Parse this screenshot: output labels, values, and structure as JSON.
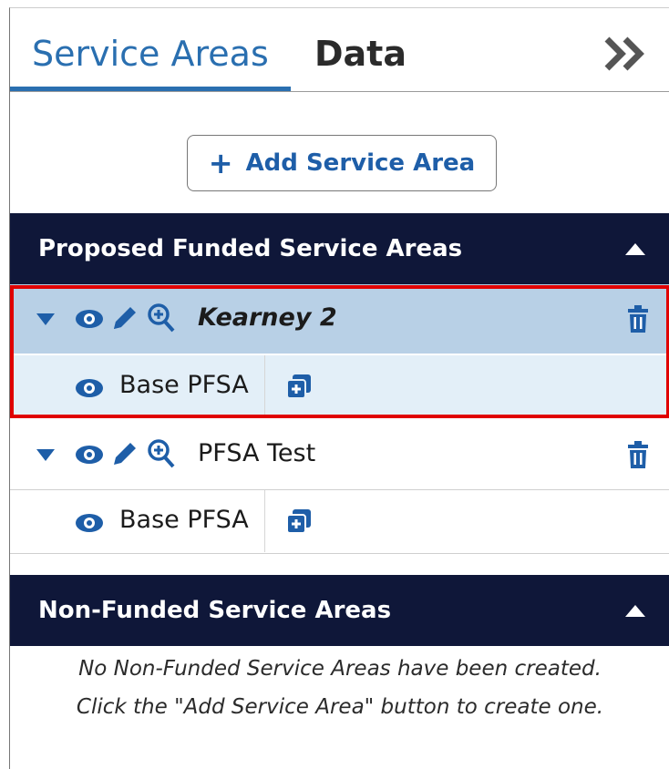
{
  "tabs": {
    "active_label": "Service Areas",
    "data_label": "Data",
    "collapse_icon": "double-chevron-right-icon"
  },
  "add_button": {
    "label": "Add Service Area",
    "plus": "+"
  },
  "funded_section": {
    "title": "Proposed Funded Service Areas",
    "areas": [
      {
        "name": "Kearney 2",
        "selected": true,
        "child_label": "Base PFSA"
      },
      {
        "name": "PFSA Test",
        "selected": false,
        "child_label": "Base PFSA"
      }
    ]
  },
  "nonfunded_section": {
    "title": "Non-Funded Service Areas",
    "empty_line1": "No Non-Funded Service Areas have been created.",
    "empty_line2": "Click the \"Add Service Area\" button to create one."
  },
  "colors": {
    "accent": "#1e5ea8",
    "header_bg": "#0f1739",
    "selected_row": "#b8d0e6",
    "selected_child": "#e3eff8",
    "highlight": "#e00000"
  }
}
